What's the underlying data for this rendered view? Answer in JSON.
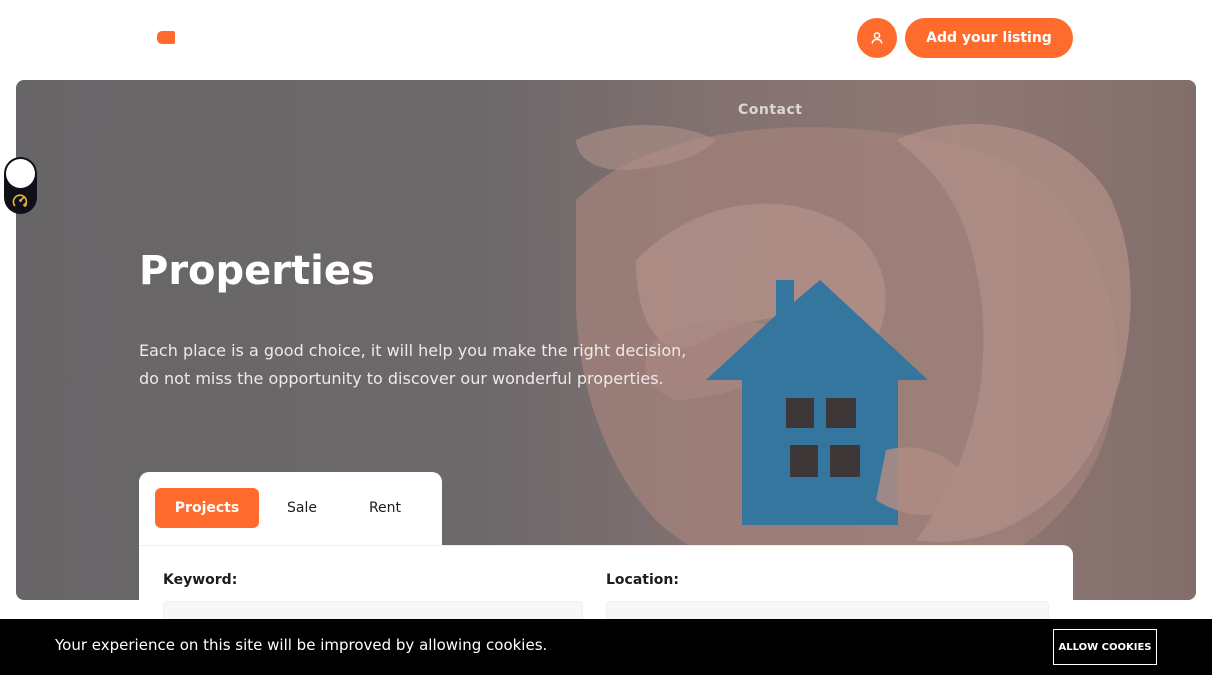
{
  "header": {
    "logo_icon": "logo-mark",
    "user_icon": "user-icon",
    "add_listing_label": "Add your listing"
  },
  "nav": {
    "contact_label": "Contact"
  },
  "hero": {
    "title": "Properties",
    "description_line1": "Each place is a good choice, it will help you make the right decision,",
    "description_line2": "do not miss the opportunity to discover our wonderful properties."
  },
  "search": {
    "tabs": [
      {
        "label": "Projects",
        "active": true
      },
      {
        "label": "Sale",
        "active": false
      },
      {
        "label": "Rent",
        "active": false
      }
    ],
    "keyword_label": "Keyword:",
    "location_label": "Location:"
  },
  "cookies": {
    "message": "Your experience on this site will be improved by allowing cookies.",
    "button_label": "ALLOW COOKIES"
  },
  "colors": {
    "accent": "#ff6b2c",
    "cookie_bar": "#000000"
  }
}
